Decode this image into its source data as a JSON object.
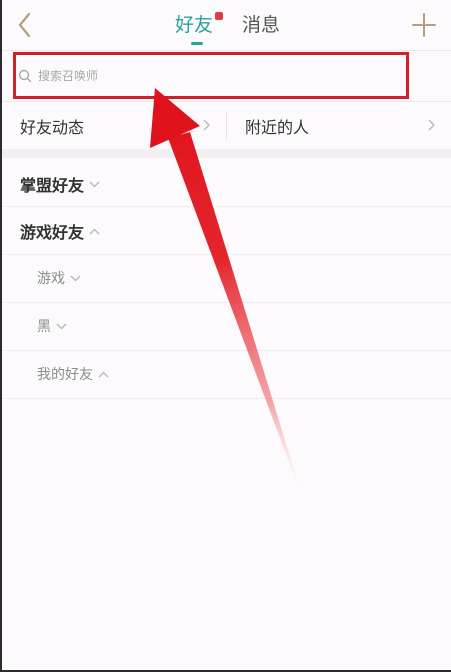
{
  "header": {
    "tab_friends": "好友",
    "tab_messages": "消息"
  },
  "search": {
    "placeholder": "搜索召唤师"
  },
  "quick_links": {
    "friend_feed": "好友动态",
    "nearby": "附近的人"
  },
  "groups": [
    {
      "label": "掌盟好友",
      "state": "collapsed"
    },
    {
      "label": "游戏好友",
      "state": "expanded"
    }
  ],
  "subgroups": [
    {
      "label": "游戏",
      "state": "collapsed"
    },
    {
      "label": "黑",
      "state": "collapsed"
    },
    {
      "label": "我的好友",
      "state": "expanded"
    }
  ],
  "colors": {
    "accent": "#2aa39c",
    "badge": "#e23a44",
    "highlight": "#d0202a"
  }
}
